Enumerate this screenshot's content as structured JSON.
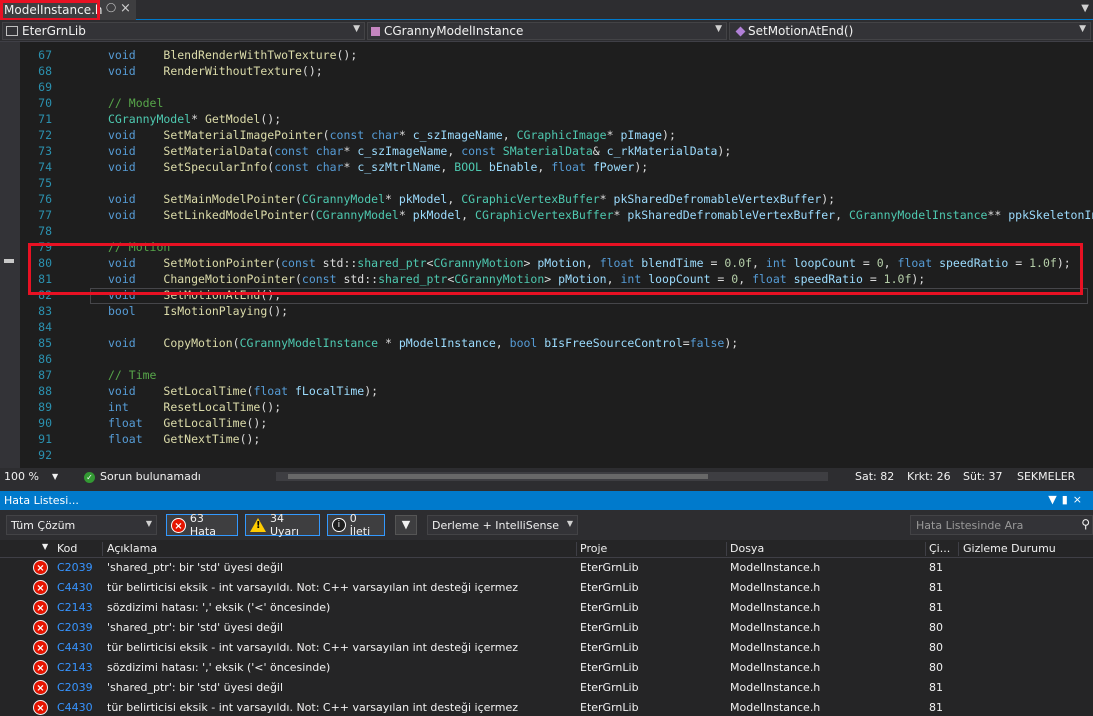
{
  "tab": {
    "filename": "ModelInstance.h",
    "pin_icon": "pin-icon",
    "close_icon": "close-icon"
  },
  "nav": {
    "project": "EterGrnLib",
    "class": "CGrannyModelInstance",
    "member": "SetMotionAtEnd()"
  },
  "editor": {
    "lines": [
      {
        "n": "67",
        "tokens": [
          [
            "kw",
            "void"
          ],
          [
            "",
            "    "
          ],
          [
            "fn",
            "BlendRenderWithTwoTexture"
          ],
          [
            "",
            "();"
          ]
        ]
      },
      {
        "n": "68",
        "tokens": [
          [
            "kw",
            "void"
          ],
          [
            "",
            "    "
          ],
          [
            "fn",
            "RenderWithoutTexture"
          ],
          [
            "",
            "();"
          ]
        ]
      },
      {
        "n": "69",
        "tokens": []
      },
      {
        "n": "70",
        "tokens": [
          [
            "cm",
            "// Model"
          ]
        ]
      },
      {
        "n": "71",
        "tokens": [
          [
            "ty",
            "CGrannyModel"
          ],
          [
            "",
            "* "
          ],
          [
            "fn",
            "GetModel"
          ],
          [
            "",
            "();"
          ]
        ]
      },
      {
        "n": "72",
        "tokens": [
          [
            "kw",
            "void"
          ],
          [
            "",
            "    "
          ],
          [
            "fn",
            "SetMaterialImagePointer"
          ],
          [
            "",
            "("
          ],
          [
            "kw",
            "const"
          ],
          [
            "",
            " "
          ],
          [
            "kw",
            "char"
          ],
          [
            "",
            "* "
          ],
          [
            "pa",
            "c_szImageName"
          ],
          [
            "",
            ", "
          ],
          [
            "ty",
            "CGraphicImage"
          ],
          [
            "",
            "* "
          ],
          [
            "pa",
            "pImage"
          ],
          [
            "",
            ");"
          ]
        ]
      },
      {
        "n": "73",
        "tokens": [
          [
            "kw",
            "void"
          ],
          [
            "",
            "    "
          ],
          [
            "fn",
            "SetMaterialData"
          ],
          [
            "",
            "("
          ],
          [
            "kw",
            "const"
          ],
          [
            "",
            " "
          ],
          [
            "kw",
            "char"
          ],
          [
            "",
            "* "
          ],
          [
            "pa",
            "c_szImageName"
          ],
          [
            "",
            ", "
          ],
          [
            "kw",
            "const"
          ],
          [
            "",
            " "
          ],
          [
            "ty",
            "SMaterialData"
          ],
          [
            "",
            "& "
          ],
          [
            "pa",
            "c_rkMaterialData"
          ],
          [
            "",
            ");"
          ]
        ]
      },
      {
        "n": "74",
        "tokens": [
          [
            "kw",
            "void"
          ],
          [
            "",
            "    "
          ],
          [
            "fn",
            "SetSpecularInfo"
          ],
          [
            "",
            "("
          ],
          [
            "kw",
            "const"
          ],
          [
            "",
            " "
          ],
          [
            "kw",
            "char"
          ],
          [
            "",
            "* "
          ],
          [
            "pa",
            "c_szMtrlName"
          ],
          [
            "",
            ", "
          ],
          [
            "ty",
            "BOOL"
          ],
          [
            "",
            " "
          ],
          [
            "pa",
            "bEnable"
          ],
          [
            "",
            ", "
          ],
          [
            "kw",
            "float"
          ],
          [
            "",
            " "
          ],
          [
            "pa",
            "fPower"
          ],
          [
            "",
            ");"
          ]
        ]
      },
      {
        "n": "75",
        "tokens": []
      },
      {
        "n": "76",
        "tokens": [
          [
            "kw",
            "void"
          ],
          [
            "",
            "    "
          ],
          [
            "fn",
            "SetMainModelPointer"
          ],
          [
            "",
            "("
          ],
          [
            "ty",
            "CGrannyModel"
          ],
          [
            "",
            "* "
          ],
          [
            "pa",
            "pkModel"
          ],
          [
            "",
            ", "
          ],
          [
            "ty",
            "CGraphicVertexBuffer"
          ],
          [
            "",
            "* "
          ],
          [
            "pa",
            "pkSharedDefromableVertexBuffer"
          ],
          [
            "",
            ");"
          ]
        ]
      },
      {
        "n": "77",
        "tokens": [
          [
            "kw",
            "void"
          ],
          [
            "",
            "    "
          ],
          [
            "fn",
            "SetLinkedModelPointer"
          ],
          [
            "",
            "("
          ],
          [
            "ty",
            "CGrannyModel"
          ],
          [
            "",
            "* "
          ],
          [
            "pa",
            "pkModel"
          ],
          [
            "",
            ", "
          ],
          [
            "ty",
            "CGraphicVertexBuffer"
          ],
          [
            "",
            "* "
          ],
          [
            "pa",
            "pkSharedDefromableVertexBuffer"
          ],
          [
            "",
            ", "
          ],
          [
            "ty",
            "CGrannyModelInstance"
          ],
          [
            "",
            "** "
          ],
          [
            "pa",
            "ppkSkeletonInst"
          ],
          [
            "",
            ");"
          ]
        ]
      },
      {
        "n": "78",
        "tokens": []
      },
      {
        "n": "79",
        "tokens": [
          [
            "cm",
            "// Motion"
          ]
        ]
      },
      {
        "n": "80",
        "tokens": [
          [
            "kw",
            "void"
          ],
          [
            "",
            "    "
          ],
          [
            "fn",
            "SetMotionPointer"
          ],
          [
            "",
            "("
          ],
          [
            "kw",
            "const"
          ],
          [
            "",
            " std::"
          ],
          [
            "ty",
            "shared_ptr"
          ],
          [
            "",
            "<"
          ],
          [
            "ty",
            "CGrannyMotion"
          ],
          [
            "",
            "> "
          ],
          [
            "pa",
            "pMotion"
          ],
          [
            "",
            ", "
          ],
          [
            "kw",
            "float"
          ],
          [
            "",
            " "
          ],
          [
            "pa",
            "blendTime"
          ],
          [
            "",
            " = "
          ],
          [
            "nu",
            "0.0f"
          ],
          [
            "",
            ", "
          ],
          [
            "kw",
            "int"
          ],
          [
            "",
            " "
          ],
          [
            "pa",
            "loopCount"
          ],
          [
            "",
            " = "
          ],
          [
            "nu",
            "0"
          ],
          [
            "",
            ", "
          ],
          [
            "kw",
            "float"
          ],
          [
            "",
            " "
          ],
          [
            "pa",
            "speedRatio"
          ],
          [
            "",
            " = "
          ],
          [
            "nu",
            "1.0f"
          ],
          [
            "",
            ");"
          ]
        ]
      },
      {
        "n": "81",
        "tokens": [
          [
            "kw",
            "void"
          ],
          [
            "",
            "    "
          ],
          [
            "fn",
            "ChangeMotionPointer"
          ],
          [
            "",
            "("
          ],
          [
            "kw",
            "const"
          ],
          [
            "",
            " std::"
          ],
          [
            "ty",
            "shared_ptr"
          ],
          [
            "",
            "<"
          ],
          [
            "ty",
            "CGrannyMotion"
          ],
          [
            "",
            "> "
          ],
          [
            "pa",
            "pMotion"
          ],
          [
            "",
            ", "
          ],
          [
            "kw",
            "int"
          ],
          [
            "",
            " "
          ],
          [
            "pa",
            "loopCount"
          ],
          [
            "",
            " = "
          ],
          [
            "nu",
            "0"
          ],
          [
            "",
            ", "
          ],
          [
            "kw",
            "float"
          ],
          [
            "",
            " "
          ],
          [
            "pa",
            "speedRatio"
          ],
          [
            "",
            " = "
          ],
          [
            "nu",
            "1.0f"
          ],
          [
            "",
            ");"
          ]
        ]
      },
      {
        "n": "82",
        "tokens": [
          [
            "kw",
            "void"
          ],
          [
            "",
            "    "
          ],
          [
            "fn",
            "SetMotionAtEnd"
          ],
          [
            "",
            "();"
          ]
        ]
      },
      {
        "n": "83",
        "tokens": [
          [
            "kw",
            "bool"
          ],
          [
            "",
            "    "
          ],
          [
            "fn",
            "IsMotionPlaying"
          ],
          [
            "",
            "();"
          ]
        ]
      },
      {
        "n": "84",
        "tokens": []
      },
      {
        "n": "85",
        "tokens": [
          [
            "kw",
            "void"
          ],
          [
            "",
            "    "
          ],
          [
            "fn",
            "CopyMotion"
          ],
          [
            "",
            "("
          ],
          [
            "ty",
            "CGrannyModelInstance"
          ],
          [
            "",
            " * "
          ],
          [
            "pa",
            "pModelInstance"
          ],
          [
            "",
            ", "
          ],
          [
            "kw",
            "bool"
          ],
          [
            "",
            " "
          ],
          [
            "pa",
            "bIsFreeSourceControl"
          ],
          [
            "",
            "="
          ],
          [
            "kw",
            "false"
          ],
          [
            "",
            ");"
          ]
        ]
      },
      {
        "n": "86",
        "tokens": []
      },
      {
        "n": "87",
        "tokens": [
          [
            "cm",
            "// Time"
          ]
        ]
      },
      {
        "n": "88",
        "tokens": [
          [
            "kw",
            "void"
          ],
          [
            "",
            "    "
          ],
          [
            "fn",
            "SetLocalTime"
          ],
          [
            "",
            "("
          ],
          [
            "kw",
            "float"
          ],
          [
            "",
            " "
          ],
          [
            "pa",
            "fLocalTime"
          ],
          [
            "",
            ");"
          ]
        ]
      },
      {
        "n": "89",
        "tokens": [
          [
            "kw",
            "int"
          ],
          [
            "",
            "     "
          ],
          [
            "fn",
            "ResetLocalTime"
          ],
          [
            "",
            "();"
          ]
        ]
      },
      {
        "n": "90",
        "tokens": [
          [
            "kw",
            "float"
          ],
          [
            "",
            "   "
          ],
          [
            "fn",
            "GetLocalTime"
          ],
          [
            "",
            "();"
          ]
        ]
      },
      {
        "n": "91",
        "tokens": [
          [
            "kw",
            "float"
          ],
          [
            "",
            "   "
          ],
          [
            "fn",
            "GetNextTime"
          ],
          [
            "",
            "();"
          ]
        ]
      },
      {
        "n": "92",
        "tokens": []
      }
    ]
  },
  "editor_status": {
    "zoom": "100 %",
    "issues": "Sorun bulunamadı",
    "line": "Sat: 82",
    "char": "Krkt: 26",
    "col": "Süt: 37",
    "mode": "SEKMELER"
  },
  "error_list": {
    "title": "Hata Listesi...",
    "scope": "Tüm Çözüm",
    "errors_btn": "63 Hata",
    "warnings_btn": "34 Uyarı",
    "messages_btn": "0 İleti",
    "build_filter": "Derleme + IntelliSense",
    "search_placeholder": "Hata Listesinde Ara",
    "headers": {
      "code": "Kod",
      "description": "Açıklama",
      "project": "Proje",
      "file": "Dosya",
      "line": "Çi...",
      "suppression": "Gizleme Durumu"
    },
    "rows": [
      {
        "code": "C2039",
        "desc": "'shared_ptr': bir 'std' üyesi değil",
        "project": "EterGrnLib",
        "file": "ModelInstance.h",
        "line": "81"
      },
      {
        "code": "C4430",
        "desc": "tür belirticisi eksik - int varsayıldı. Not: C++ varsayılan int desteği içermez",
        "project": "EterGrnLib",
        "file": "ModelInstance.h",
        "line": "81"
      },
      {
        "code": "C2143",
        "desc": "sözdizimi hatası: ',' eksik ('<' öncesinde)",
        "project": "EterGrnLib",
        "file": "ModelInstance.h",
        "line": "81"
      },
      {
        "code": "C2039",
        "desc": "'shared_ptr': bir 'std' üyesi değil",
        "project": "EterGrnLib",
        "file": "ModelInstance.h",
        "line": "80"
      },
      {
        "code": "C4430",
        "desc": "tür belirticisi eksik - int varsayıldı. Not: C++ varsayılan int desteği içermez",
        "project": "EterGrnLib",
        "file": "ModelInstance.h",
        "line": "80"
      },
      {
        "code": "C2143",
        "desc": "sözdizimi hatası: ',' eksik ('<' öncesinde)",
        "project": "EterGrnLib",
        "file": "ModelInstance.h",
        "line": "80"
      },
      {
        "code": "C2039",
        "desc": "'shared_ptr': bir 'std' üyesi değil",
        "project": "EterGrnLib",
        "file": "ModelInstance.h",
        "line": "81"
      },
      {
        "code": "C4430",
        "desc": "tür belirticisi eksik - int varsayıldı. Not: C++ varsayılan int desteği içermez",
        "project": "EterGrnLib",
        "file": "ModelInstance.h",
        "line": "81"
      }
    ]
  },
  "colors": {
    "accent": "#007acc",
    "highlight_box": "#e81123",
    "error": "#e51400",
    "warning": "#ffcc00"
  }
}
